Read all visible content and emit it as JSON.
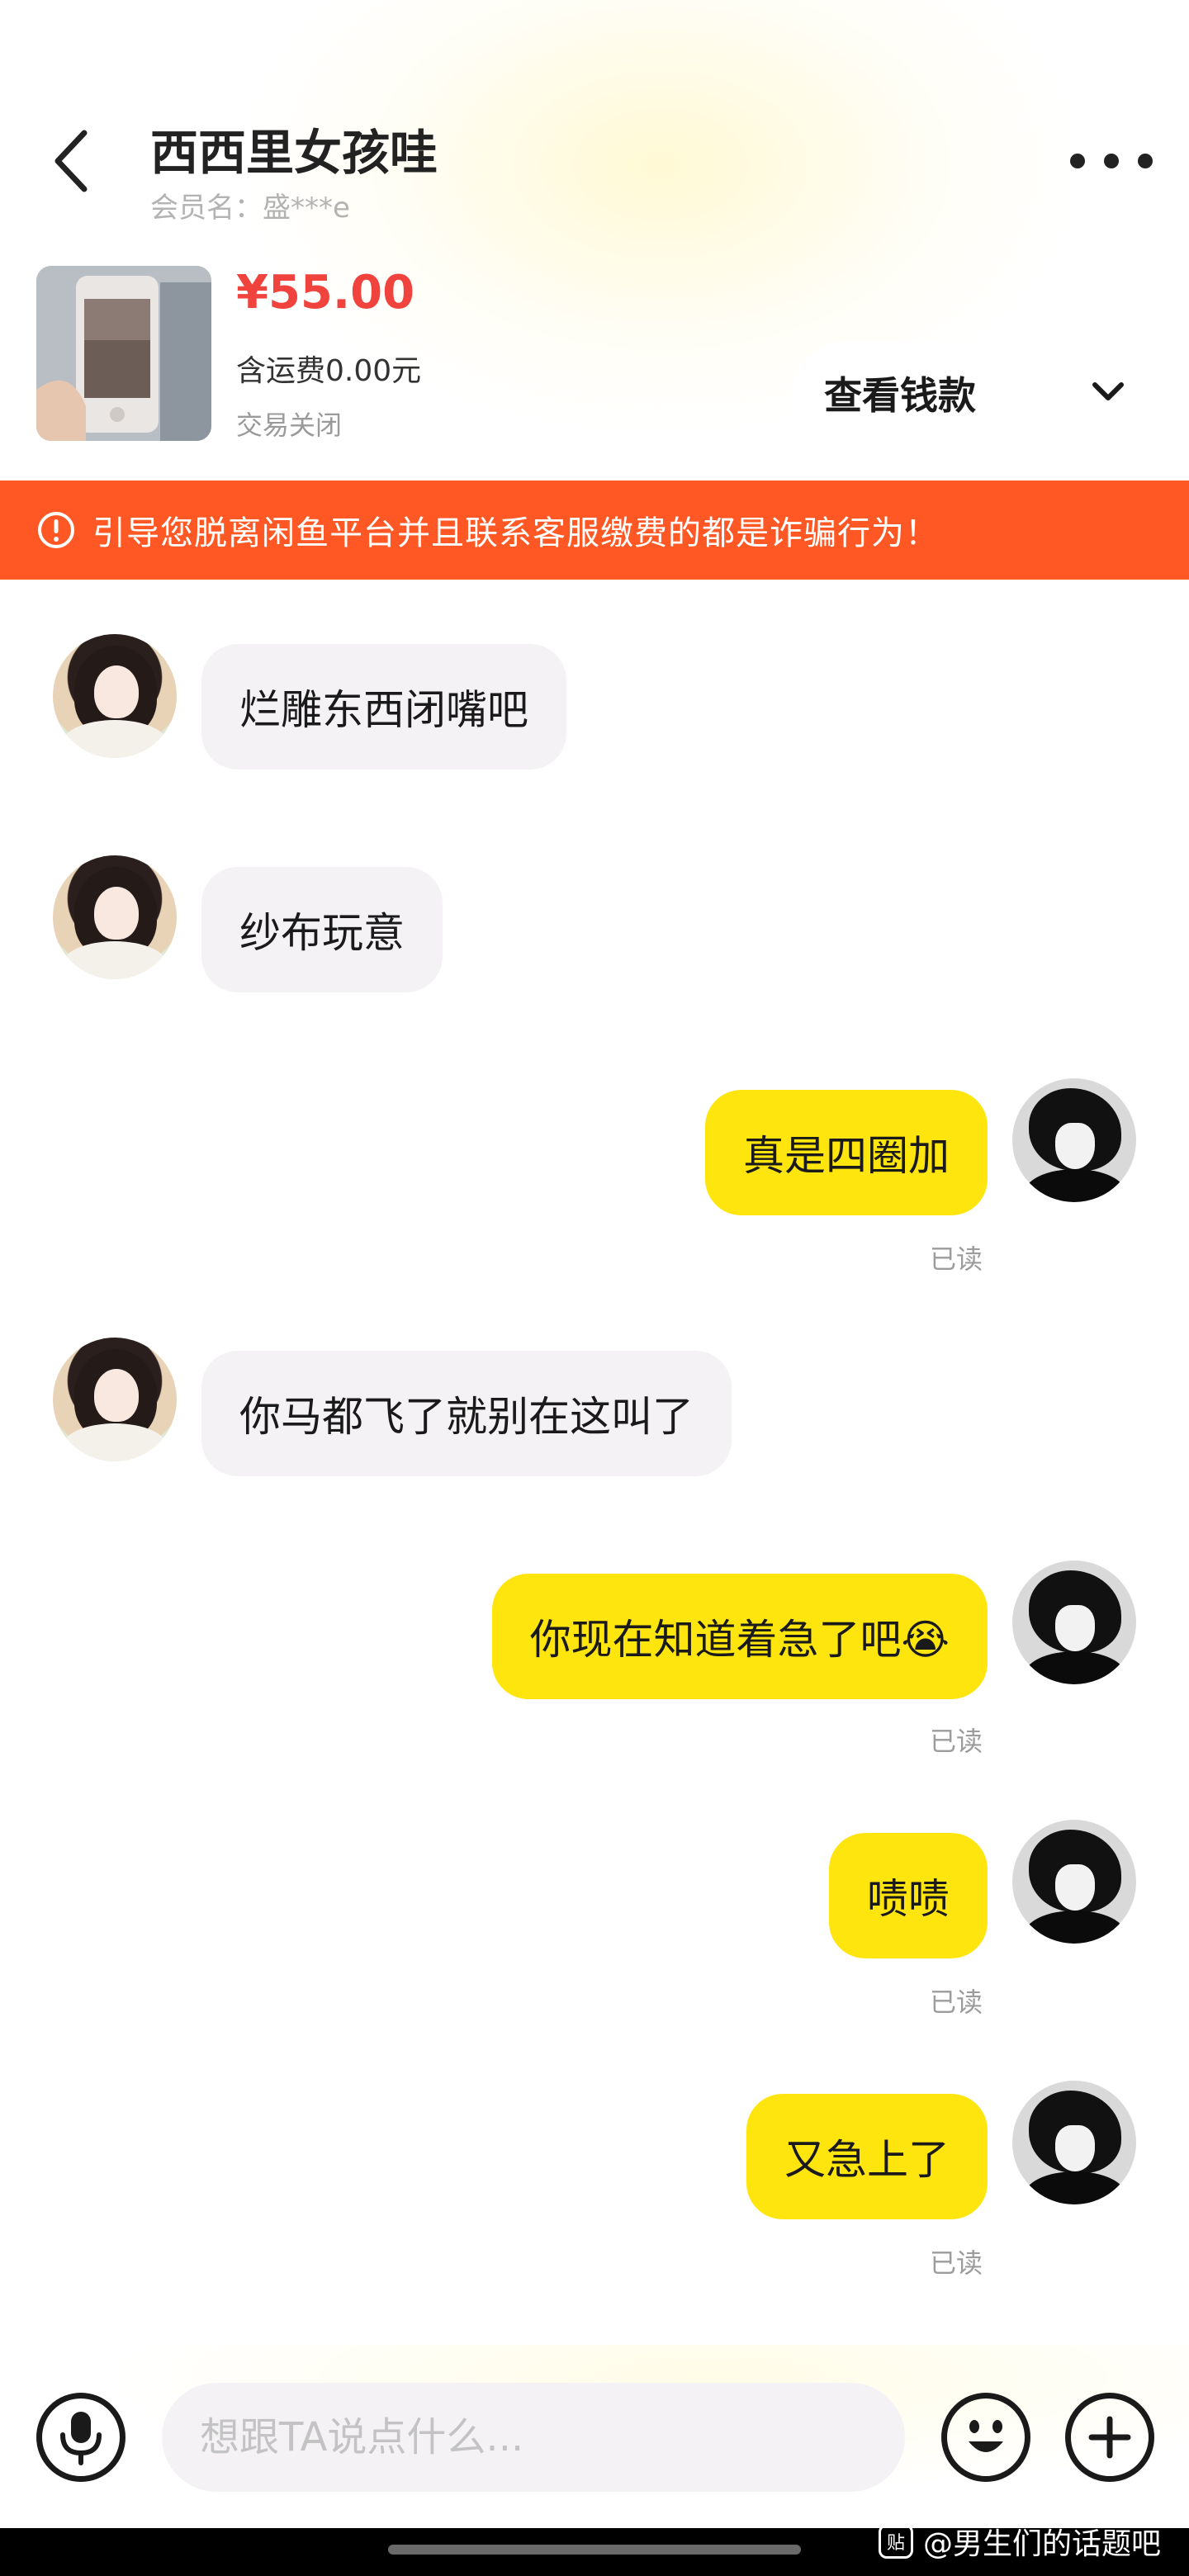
{
  "header": {
    "title": "西西里女孩哇",
    "member_label": "会员名：",
    "member_name": "盛***e",
    "back_icon": "chevron-left-icon",
    "more_icon": "more-dots-icon"
  },
  "product": {
    "price": "¥55.00",
    "shipping": "含运费0.00元",
    "status": "交易关闭",
    "view_money_label": "查看钱款"
  },
  "warning": {
    "text": "引导您脱离闲鱼平台并且联系客服缴费的都是诈骗行为！",
    "color": "#ff5824"
  },
  "messages": [
    {
      "side": "left",
      "text": "烂雕东西闭嘴吧"
    },
    {
      "side": "left",
      "text": "纱布玩意"
    },
    {
      "side": "right",
      "text": "真是四圈加",
      "read": "已读"
    },
    {
      "side": "left",
      "text": "你马都飞了就别在这叫了"
    },
    {
      "side": "right",
      "text": "你现在知道着急了吧😭",
      "read": "已读"
    },
    {
      "side": "right",
      "text": "啧啧",
      "read": "已读"
    },
    {
      "side": "right",
      "text": "又急上了",
      "read": "已读"
    }
  ],
  "input": {
    "placeholder": "想跟TA说点什么..."
  },
  "watermark": {
    "logo": "贴",
    "text": "@男生们的话题吧"
  },
  "colors": {
    "accent_yellow": "#ffe50e",
    "price_red": "#f0433d",
    "bubble_gray": "#f4f2f5"
  }
}
